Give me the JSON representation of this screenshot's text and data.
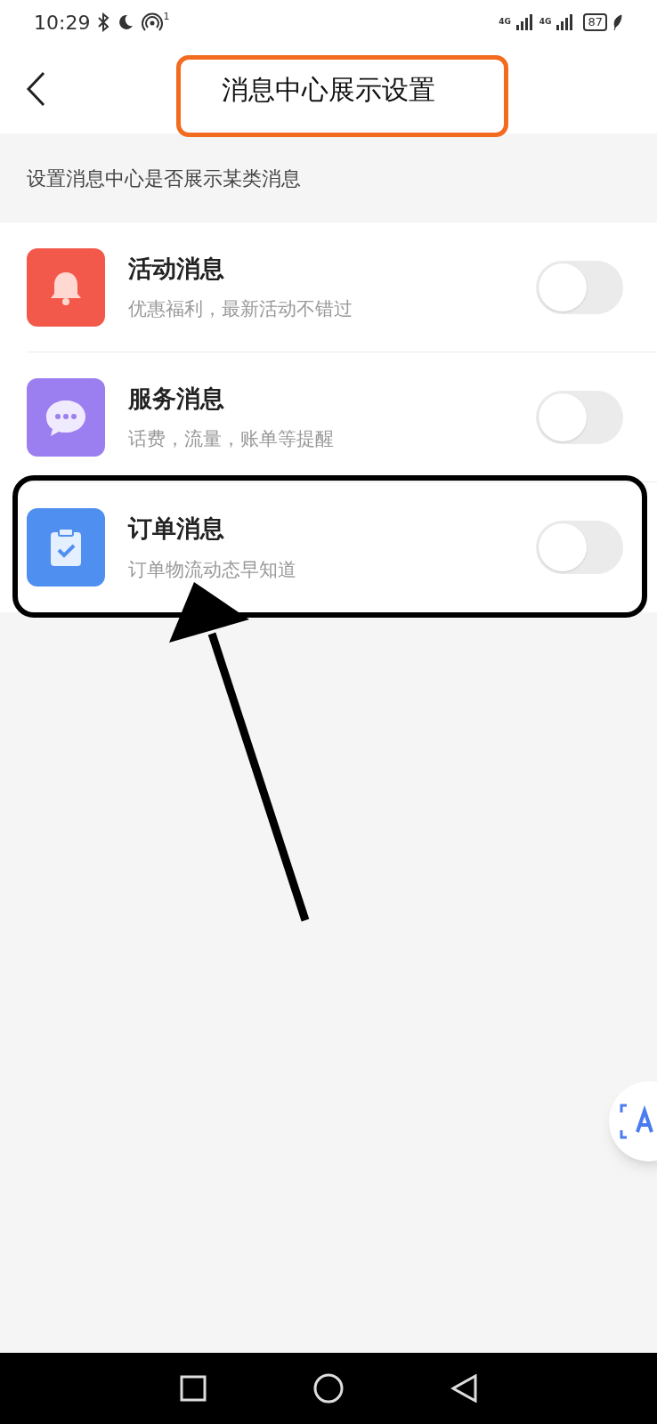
{
  "status_bar": {
    "time": "10:29",
    "hotspot_count": "1",
    "network_1": "4G",
    "network_2": "4G",
    "battery": "87"
  },
  "header": {
    "title": "消息中心展示设置",
    "highlighted": true
  },
  "section_hint": "设置消息中心是否展示某类消息",
  "settings": [
    {
      "kind": "bell",
      "title": "活动消息",
      "subtitle": "优惠福利，最新活动不错过",
      "on": false,
      "highlighted": false
    },
    {
      "kind": "chat",
      "title": "服务消息",
      "subtitle": "话费，流量，账单等提醒",
      "on": false,
      "highlighted": false
    },
    {
      "kind": "clipboard",
      "title": "订单消息",
      "subtitle": "订单物流动态早知道",
      "on": false,
      "highlighted": true,
      "arrow": true
    }
  ]
}
